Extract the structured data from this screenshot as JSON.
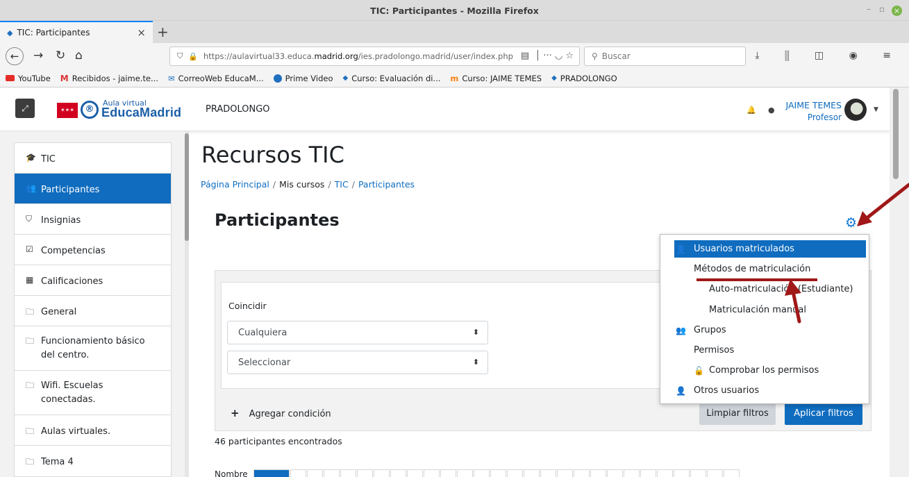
{
  "window": {
    "title": "TIC: Participantes - Mozilla Firefox",
    "min": "–",
    "max": "▫",
    "close": "×"
  },
  "tab": {
    "label": "TIC: Participantes",
    "close": "×",
    "new": "+"
  },
  "nav": {
    "url_prefix": "https://aulavirtual33.educa.",
    "url_host": "madrid.org",
    "url_path": "/ies.pradolongo.madrid/user/index.php",
    "search_placeholder": "Buscar"
  },
  "bookmarks": [
    {
      "label": "YouTube",
      "icon": "youtube-icon"
    },
    {
      "label": "Recibidos - jaime.te...",
      "icon": "gmail-icon"
    },
    {
      "label": "CorreoWeb EducaM...",
      "icon": "mail-icon"
    },
    {
      "label": "Prime Video",
      "icon": "prime-video-icon"
    },
    {
      "label": "Curso: Evaluación di...",
      "icon": "graduation-cap-icon"
    },
    {
      "label": "Curso: JAIME TEMES",
      "icon": "moodle-icon"
    },
    {
      "label": "PRADOLONGO",
      "icon": "graduation-cap-icon"
    }
  ],
  "header": {
    "logo_small": "Aula virtual",
    "logo_big": "EducaMadrid",
    "site_name": "PRADOLONGO",
    "user_name": "JAIME TEMES",
    "user_role": "Profesor"
  },
  "sidebar": {
    "items": [
      {
        "label": "TIC",
        "icon": "graduation-cap-icon",
        "glyph": "🎓",
        "active": false
      },
      {
        "label": "Participantes",
        "icon": "users-icon",
        "glyph": "👥",
        "active": true
      },
      {
        "label": "Insignias",
        "icon": "shield-icon",
        "glyph": "⛉",
        "active": false
      },
      {
        "label": "Competencias",
        "icon": "check-square-icon",
        "glyph": "☑",
        "active": false
      },
      {
        "label": "Calificaciones",
        "icon": "table-icon",
        "glyph": "▦",
        "active": false
      },
      {
        "label": "General",
        "icon": "folder-icon",
        "glyph": "🗀",
        "active": false
      },
      {
        "label": "Funcionamiento básico del centro.",
        "icon": "folder-icon",
        "glyph": "🗀",
        "active": false
      },
      {
        "label": "Wifi. Escuelas conectadas.",
        "icon": "folder-icon",
        "glyph": "🗀",
        "active": false
      },
      {
        "label": "Aulas virtuales.",
        "icon": "folder-icon",
        "glyph": "🗀",
        "active": false
      },
      {
        "label": "Tema 4",
        "icon": "folder-icon",
        "glyph": "🗀",
        "active": false
      }
    ]
  },
  "main": {
    "course_title": "Recursos TIC",
    "breadcrumb": {
      "home": "Página Principal",
      "mycourses": "Mis cursos",
      "course": "TIC",
      "current": "Participantes",
      "sep": "/"
    },
    "page_title": "Participantes",
    "filter": {
      "label": "Coincidir",
      "match_value": "Cualquiera",
      "select_value": "Seleccionar",
      "add_condition": "Agregar condición",
      "clear": "Limpiar filtros",
      "apply": "Aplicar filtros"
    },
    "found_text": "46 participantes encontrados",
    "initials_label": "Nombre"
  },
  "menu": {
    "items": [
      {
        "label": "Usuarios matriculados",
        "icon": "user-plus-icon",
        "glyph": "👤",
        "highlight": true
      },
      {
        "label": "Métodos de matriculación",
        "icon": "",
        "glyph": "",
        "highlight": false
      },
      {
        "label": "Auto-matriculación (Estudiante)",
        "icon": "",
        "glyph": "",
        "highlight": false
      },
      {
        "label": "Matriculación manual",
        "icon": "",
        "glyph": "",
        "highlight": false
      },
      {
        "label": "Grupos",
        "icon": "users-icon",
        "glyph": "👥",
        "highlight": false
      },
      {
        "label": "Permisos",
        "icon": "",
        "glyph": "",
        "highlight": false
      },
      {
        "label": "Comprobar los permisos",
        "icon": "unlock-icon",
        "glyph": "🔓",
        "highlight": false
      },
      {
        "label": "Otros usuarios",
        "icon": "user-plus-icon",
        "glyph": "👤",
        "highlight": false
      }
    ]
  },
  "colors": {
    "primary": "#0f6cbf",
    "annotation": "#a01818"
  }
}
